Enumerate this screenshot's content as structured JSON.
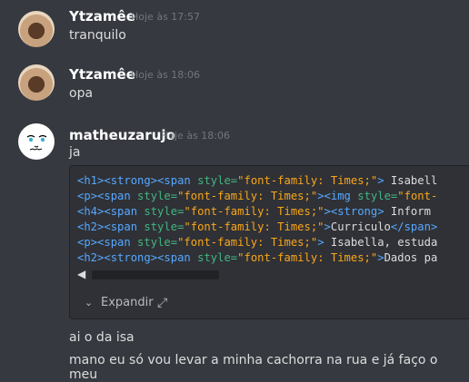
{
  "messages": [
    {
      "username": "Ytzamêe",
      "timestamp": "Hoje às 17:57",
      "text": "tranquilo",
      "avatar": "avatar-photo"
    },
    {
      "username": "Ytzamêe",
      "timestamp": "Hoje às 18:06",
      "text": "opa",
      "avatar": "avatar-photo"
    },
    {
      "username": "matheuzarujo",
      "timestamp": "Hoje às 18:06",
      "text": "ja",
      "avatar": "avatar-face-drawing"
    }
  ],
  "code_block": {
    "lines": [
      "<h1><strong><span style=\"font-family: Times;\"> Isabell",
      "<p><span style=\"font-family: Times;\"><img style=\"font-",
      "<h4><span style=\"font-family: Times;\"><strong> Inform",
      "<h2><span style=\"font-family: Times;\">Curriculo</span>",
      "<p><span style=\"font-family: Times;\"> Isabella, estuda",
      "<h2><strong><span style=\"font-family: Times;\">Dados pa"
    ],
    "expand_label": "Expandir",
    "expand_icon": "expand-arrows-icon",
    "collapse_icon": "chevron-down-icon"
  },
  "followups": [
    "ai o da isa",
    "mano eu só vou levar a minha cachorra na rua e já faço o meu"
  ],
  "colors": {
    "background": "#36393f",
    "codebox": "#2f3136",
    "tag": "#57a8ff",
    "attr": "#43b581",
    "value": "#faa61a"
  }
}
